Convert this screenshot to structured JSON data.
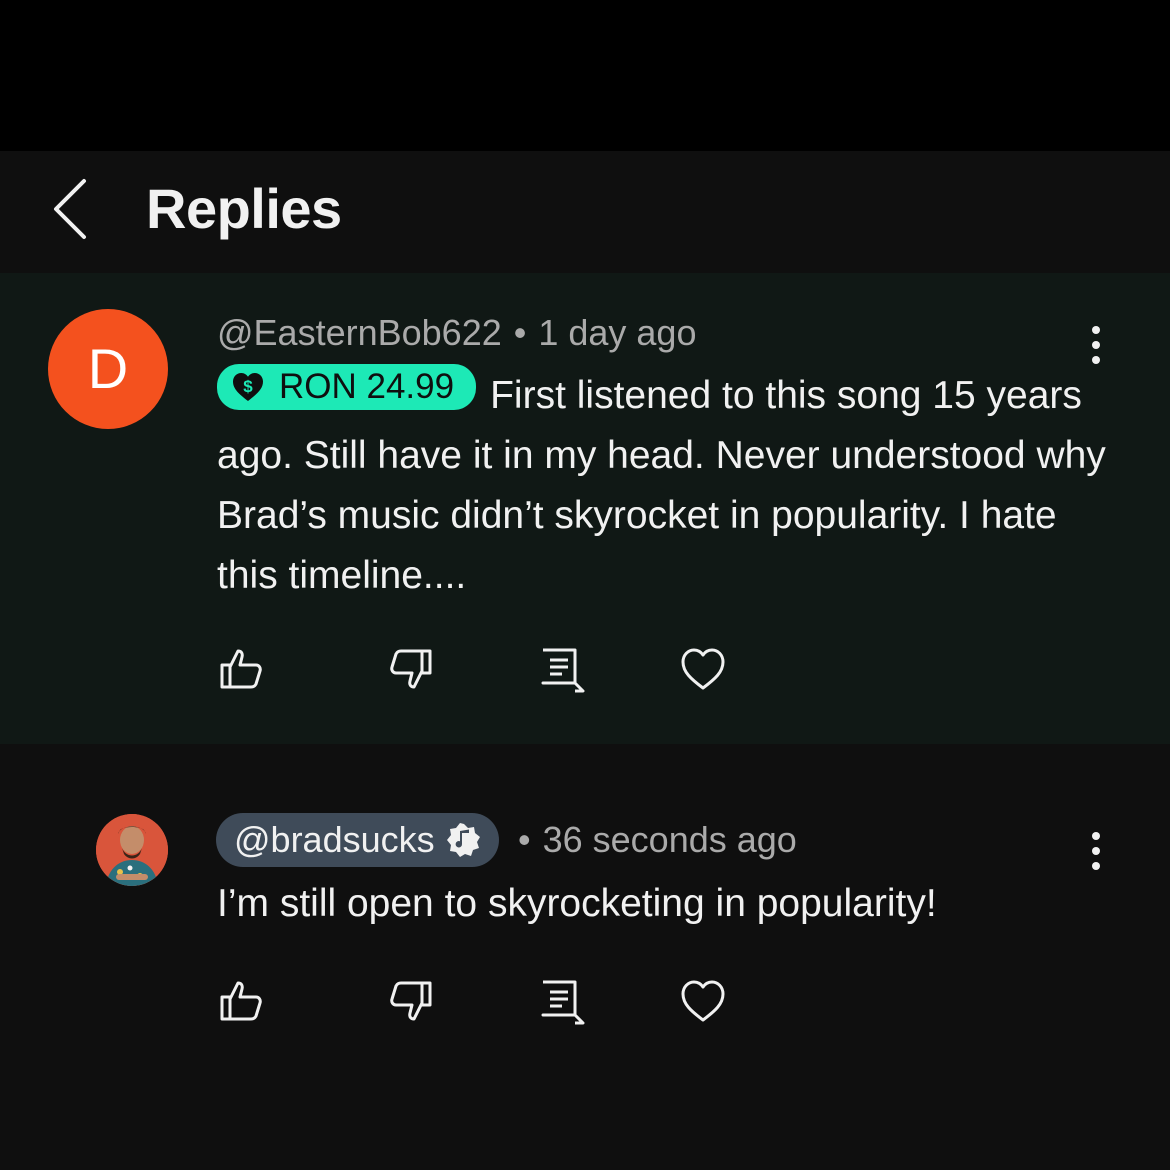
{
  "header": {
    "back_icon": "chevron-left-icon",
    "title": "Replies"
  },
  "parent_comment": {
    "avatar_letter": "D",
    "avatar_color": "#f4511e",
    "author": "@EasternBob622",
    "separator": "•",
    "timestamp": "1 day ago",
    "super_thanks": {
      "icon": "heart-dollar-icon",
      "amount": "RON 24.99",
      "color": "#1de9b6"
    },
    "text": "First listened to this song 15 years ago. Still have it in my head. Never understood why Brad’s music didn’t skyrocket in popularity. I hate this timeline....",
    "actions": [
      "like-icon",
      "dislike-icon",
      "reply-icon",
      "heart-icon"
    ]
  },
  "reply_comment": {
    "author": "@bradsucks",
    "badge_icon": "music-note-badge-icon",
    "separator": "•",
    "timestamp": "36 seconds ago",
    "text": "I’m still open to skyrocketing in popularity!",
    "actions": [
      "like-icon",
      "dislike-icon",
      "reply-icon",
      "heart-icon"
    ]
  }
}
